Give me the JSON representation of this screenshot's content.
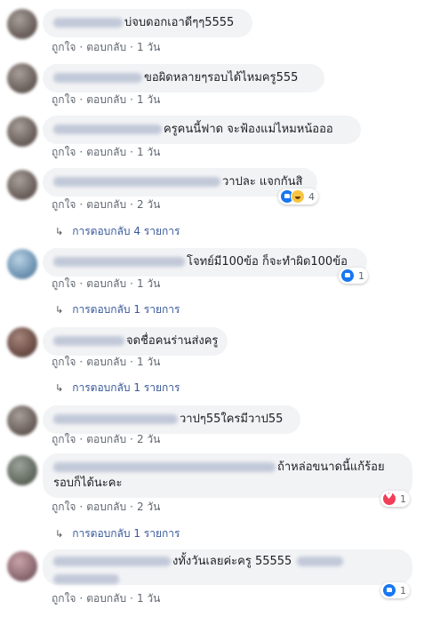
{
  "actions": {
    "like": "ถูกใจ",
    "reply": "ตอบกลับ",
    "sep": "·"
  },
  "comments": [
    {
      "text": "บ่จบดอกเอาดีๆๆ5555",
      "time": "1 วัน"
    },
    {
      "text": "ขอผิดหลายๆรอบได้ไหมครู555",
      "time": "1 วัน"
    },
    {
      "text": "ครูคนนี้ฟาด จะฟ้องแม่ไหมหน้อออ",
      "time": "1 วัน"
    },
    {
      "text": "วาปละ แจกกันสิ",
      "time": "2 วัน",
      "reactions": {
        "icons": [
          "like-icon",
          "haha-icon"
        ],
        "count": "4"
      },
      "replies": "การตอบกลับ 4 รายการ"
    },
    {
      "text": "โจทย์มี100ข้อ ก็จะทำผิด100ข้อ",
      "time": "1 วัน",
      "reactions": {
        "icons": [
          "like-icon"
        ],
        "count": "1"
      },
      "replies": "การตอบกลับ 1 รายการ"
    },
    {
      "text": "จดชื่อคนร่านส่งครู",
      "time": "1 วัน",
      "replies": "การตอบกลับ 1 รายการ"
    },
    {
      "text": "วาปๆ55ใครมีวาป55",
      "time": "2 วัน"
    },
    {
      "text_line1": "ถ้าหล่อขนาดนี้แก้ร้อย",
      "text_line2": "รอบก็ได้นะคะ",
      "time": "2 วัน",
      "reactions": {
        "icons": [
          "love-icon"
        ],
        "count": "1"
      },
      "replies": "การตอบกลับ 1 รายการ"
    },
    {
      "text": "งทั้งวันเลยค่ะครู 55555",
      "time": "1 วัน",
      "reactions": {
        "icons": [
          "like-icon"
        ],
        "count": "1"
      }
    }
  ]
}
